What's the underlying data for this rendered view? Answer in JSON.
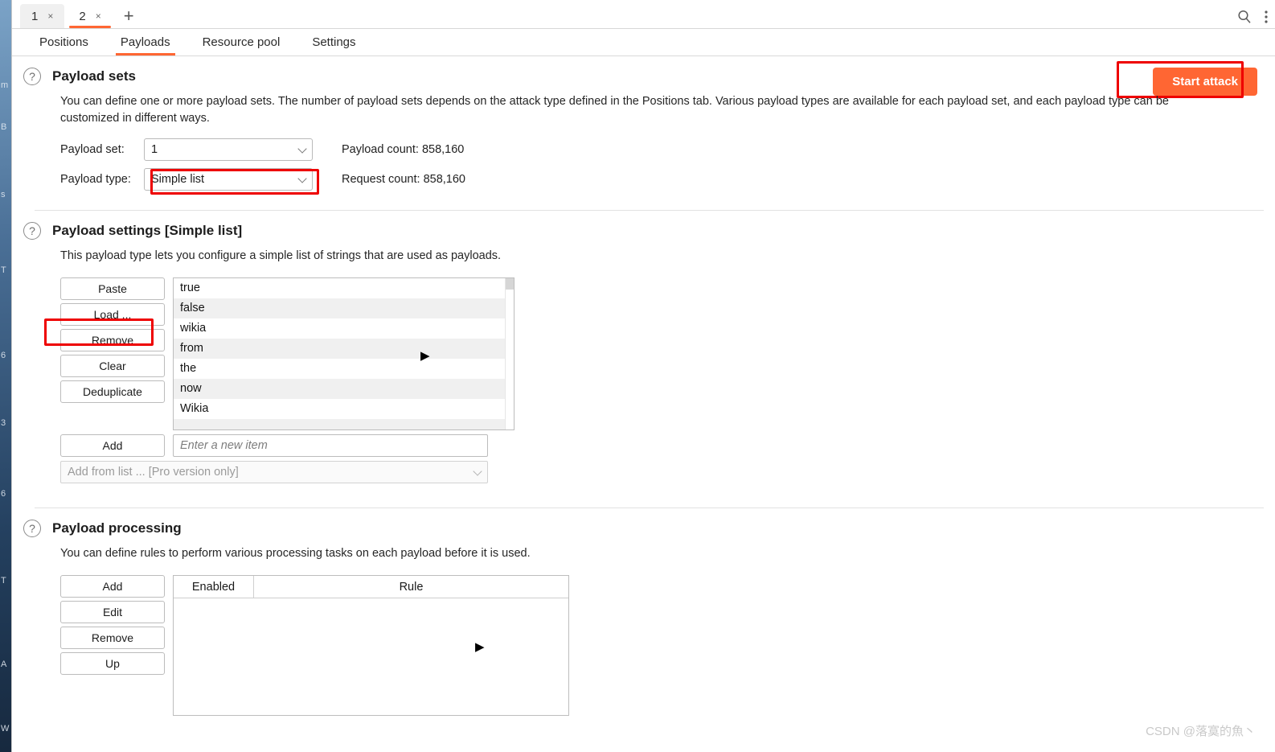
{
  "window": {
    "tabs": [
      {
        "label": "1",
        "close": "×",
        "active": false
      },
      {
        "label": "2",
        "close": "×",
        "active": true
      }
    ],
    "add_tab": "+",
    "search_icon": "search-icon",
    "menu_icon": "kebab-menu-icon"
  },
  "section_tabs": [
    {
      "label": "Positions",
      "active": false
    },
    {
      "label": "Payloads",
      "active": true
    },
    {
      "label": "Resource pool",
      "active": false
    },
    {
      "label": "Settings",
      "active": false
    }
  ],
  "start_attack": {
    "label": "Start attack",
    "color": "#ff6633"
  },
  "payload_sets": {
    "title": "Payload sets",
    "help_icon": "question-mark-icon",
    "description": "You can define one or more payload sets. The number of payload sets depends on the attack type defined in the Positions tab. Various payload types are available for each payload set, and each payload type can be customized in different ways.",
    "payload_set_label": "Payload set:",
    "payload_set_value": "1",
    "payload_type_label": "Payload type:",
    "payload_type_value": "Simple list",
    "payload_count": "Payload count: 858,160",
    "request_count": "Request count: 858,160"
  },
  "payload_settings": {
    "title": "Payload settings [Simple list]",
    "help_icon": "question-mark-icon",
    "description": "This payload type lets you configure a simple list of strings that are used as payloads.",
    "buttons": [
      "Paste",
      "Load ...",
      "Remove",
      "Clear",
      "Deduplicate"
    ],
    "items": [
      "true",
      "false",
      "wikia",
      "from",
      "the",
      "now",
      "Wikia"
    ],
    "add_button": "Add",
    "add_placeholder": "Enter a new item",
    "add_value": "",
    "add_from_list": "Add from list ... [Pro version only]",
    "expander_icon": "triangle-right-icon"
  },
  "payload_processing": {
    "title": "Payload processing",
    "help_icon": "question-mark-icon",
    "description": "You can define rules to perform various processing tasks on each payload before it is used.",
    "buttons": [
      "Add",
      "Edit",
      "Remove",
      "Up"
    ],
    "columns": [
      "Enabled",
      "Rule"
    ],
    "rows": [],
    "expander_icon": "triangle-right-icon"
  },
  "annotations": {
    "color": "#ee0000",
    "targets": [
      "start-attack-button",
      "payload-type-combo",
      "load-button"
    ]
  },
  "background_fragments": [
    "m",
    "B",
    "s",
    "T",
    "6",
    "3",
    "6",
    "T",
    "A",
    "W"
  ],
  "watermark": "CSDN @落寞的魚丶"
}
